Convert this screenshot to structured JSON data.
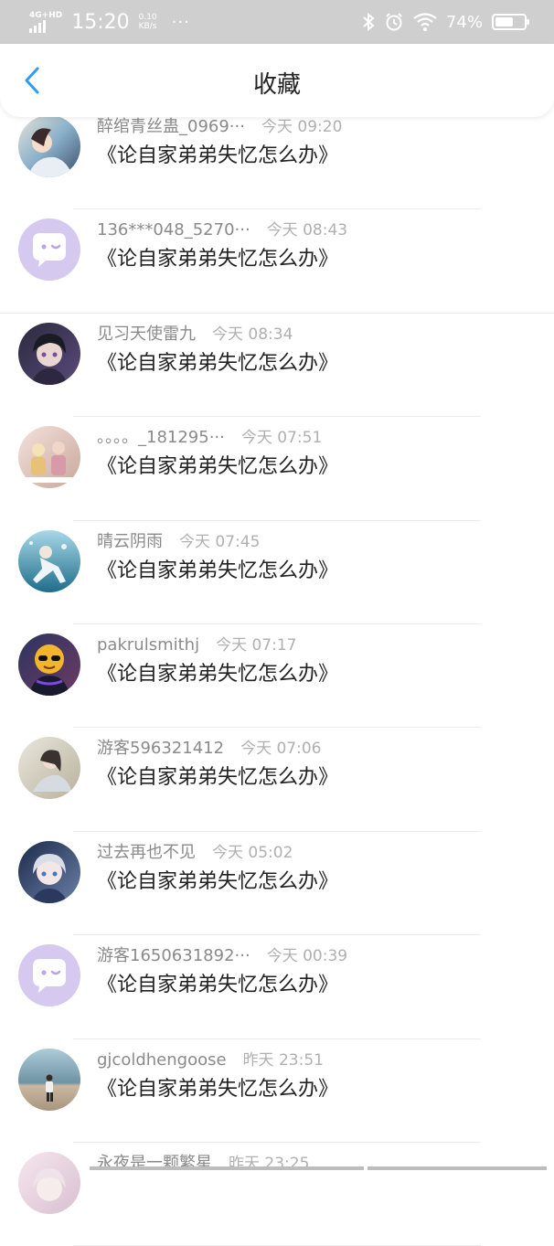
{
  "status_bar": {
    "network": "4G+HD",
    "time": "15:20",
    "speed_value": "0.10",
    "speed_unit": "KB/s",
    "more": "···",
    "battery": "74%",
    "battery_level": 0.74
  },
  "header": {
    "title": "收藏",
    "back_icon": "chevron-left-icon",
    "accent_color": "#2f9cf0"
  },
  "favorites": [
    {
      "user": "醉绾青丝蛊_0969···",
      "time": "今天 09:20",
      "title": "《论自家弟弟失忆怎么办》",
      "avatar": "anime-girl-blue"
    },
    {
      "user": "136***048_5270···",
      "time": "今天 08:43",
      "title": "《论自家弟弟失忆怎么办》",
      "avatar": "default-chat-bubble"
    },
    {
      "user": "见习天使雷九",
      "time": "今天 08:34",
      "title": "《论自家弟弟失忆怎么办》",
      "avatar": "anime-boy-dark"
    },
    {
      "user": "。。。。_181295···",
      "time": "今天 07:51",
      "title": "《论自家弟弟失忆怎么办》",
      "avatar": "anime-group-pastel"
    },
    {
      "user": "晴云阴雨",
      "time": "今天 07:45",
      "title": "《论自家弟弟失忆怎么办》",
      "avatar": "underwater-figure"
    },
    {
      "user": "pakrulsmithj",
      "time": "今天 07:17",
      "title": "《论自家弟弟失忆怎么办》",
      "avatar": "emoji-sunglasses"
    },
    {
      "user": "游客596321412",
      "time": "今天 07:06",
      "title": "《论自家弟弟失忆怎么办》",
      "avatar": "anime-girl-light"
    },
    {
      "user": "过去再也不见",
      "time": "今天 05:02",
      "title": "《论自家弟弟失忆怎么办》",
      "avatar": "anime-girl-silver"
    },
    {
      "user": "游客1650631892···",
      "time": "今天 00:39",
      "title": "《论自家弟弟失忆怎么办》",
      "avatar": "default-chat-bubble"
    },
    {
      "user": "gjcoldhengoose",
      "time": "昨天 23:51",
      "title": "《论自家弟弟失忆怎么办》",
      "avatar": "beach-person"
    },
    {
      "user": "永夜是一颗繁星",
      "time": "昨天 23:25",
      "title": "",
      "avatar": "anime-girl-pink"
    }
  ]
}
